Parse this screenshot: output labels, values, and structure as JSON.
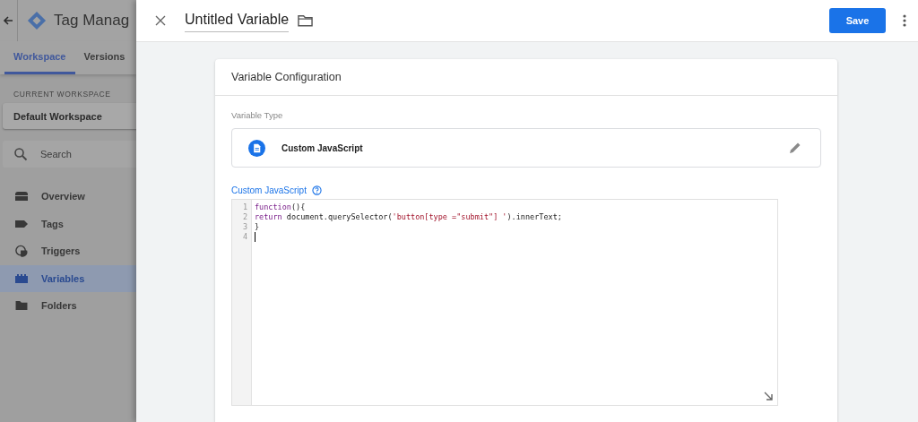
{
  "app": {
    "title": "Tag Manag",
    "tabs": [
      {
        "label": "Workspace",
        "selected": true
      },
      {
        "label": "Versions",
        "selected": false
      }
    ],
    "workspace": {
      "heading": "CURRENT WORKSPACE",
      "name": "Default Workspace"
    },
    "search": {
      "placeholder": "Search"
    },
    "nav": [
      {
        "label": "Overview",
        "kind": "overview",
        "selected": false
      },
      {
        "label": "Tags",
        "kind": "tag",
        "selected": false
      },
      {
        "label": "Triggers",
        "kind": "trigger",
        "selected": false
      },
      {
        "label": "Variables",
        "kind": "variable",
        "selected": true
      },
      {
        "label": "Folders",
        "kind": "folder",
        "selected": false
      }
    ]
  },
  "panel": {
    "title": "Untitled Variable",
    "save": "Save",
    "card": {
      "title": "Variable Configuration",
      "type_label": "Variable Type",
      "type_name": "Custom JavaScript",
      "code_label": "Custom JavaScript",
      "lines": [
        {
          "number": "1",
          "cursor": false,
          "tokens": [
            {
              "text": "function",
              "kind": "keyword"
            },
            {
              "text": "(){",
              "kind": "plain"
            }
          ]
        },
        {
          "number": "2",
          "cursor": false,
          "tokens": [
            {
              "text": "return",
              "kind": "keyword"
            },
            {
              "text": " document.querySelector(",
              "kind": "plain"
            },
            {
              "text": "'button[type =\"submit\"] '",
              "kind": "string"
            },
            {
              "text": ").innerText;",
              "kind": "plain"
            }
          ]
        },
        {
          "number": "3",
          "cursor": false,
          "tokens": [
            {
              "text": "}",
              "kind": "plain"
            }
          ]
        },
        {
          "number": "4",
          "cursor": true
        }
      ]
    }
  }
}
